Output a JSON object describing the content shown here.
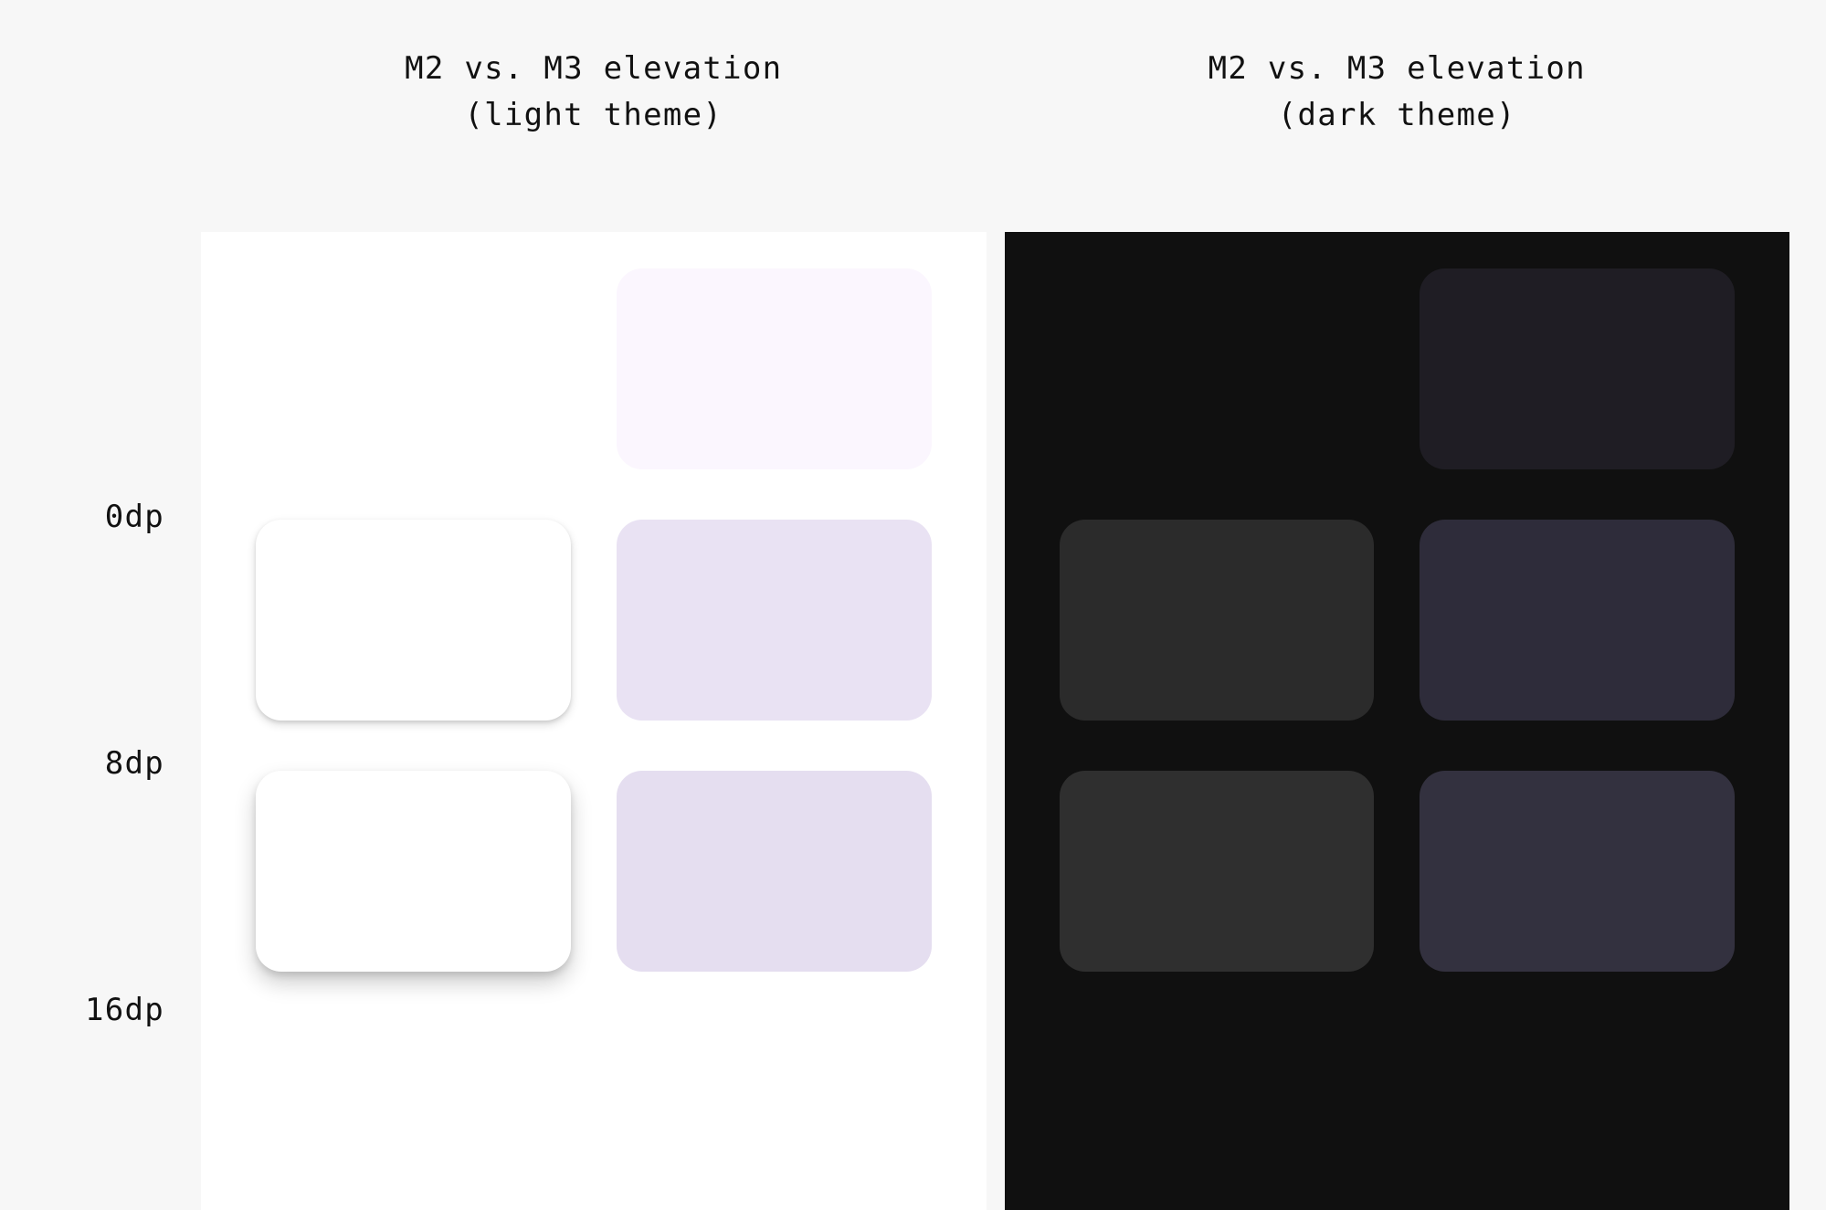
{
  "headers": {
    "light": {
      "line1": "M2 vs. M3 elevation",
      "line2": "(light theme)"
    },
    "dark": {
      "line1": "M2 vs. M3 elevation",
      "line2": "(dark theme)"
    }
  },
  "row_labels": [
    "0dp",
    "8dp",
    "16dp"
  ],
  "panels": {
    "light": {
      "bg": "#ffffff",
      "rows": [
        {
          "m2": "#ffffff",
          "m3": "#FBF6FE"
        },
        {
          "m2": "#ffffff",
          "m3": "#E9E2F3"
        },
        {
          "m2": "#ffffff",
          "m3": "#E5DEF0"
        }
      ]
    },
    "dark": {
      "bg": "#101010",
      "rows": [
        {
          "m2": "#101010",
          "m3": "#1F1D24"
        },
        {
          "m2": "#2b2b2b",
          "m3": "#2E2C3A"
        },
        {
          "m2": "#2f2f2f",
          "m3": "#33313F"
        }
      ]
    }
  }
}
